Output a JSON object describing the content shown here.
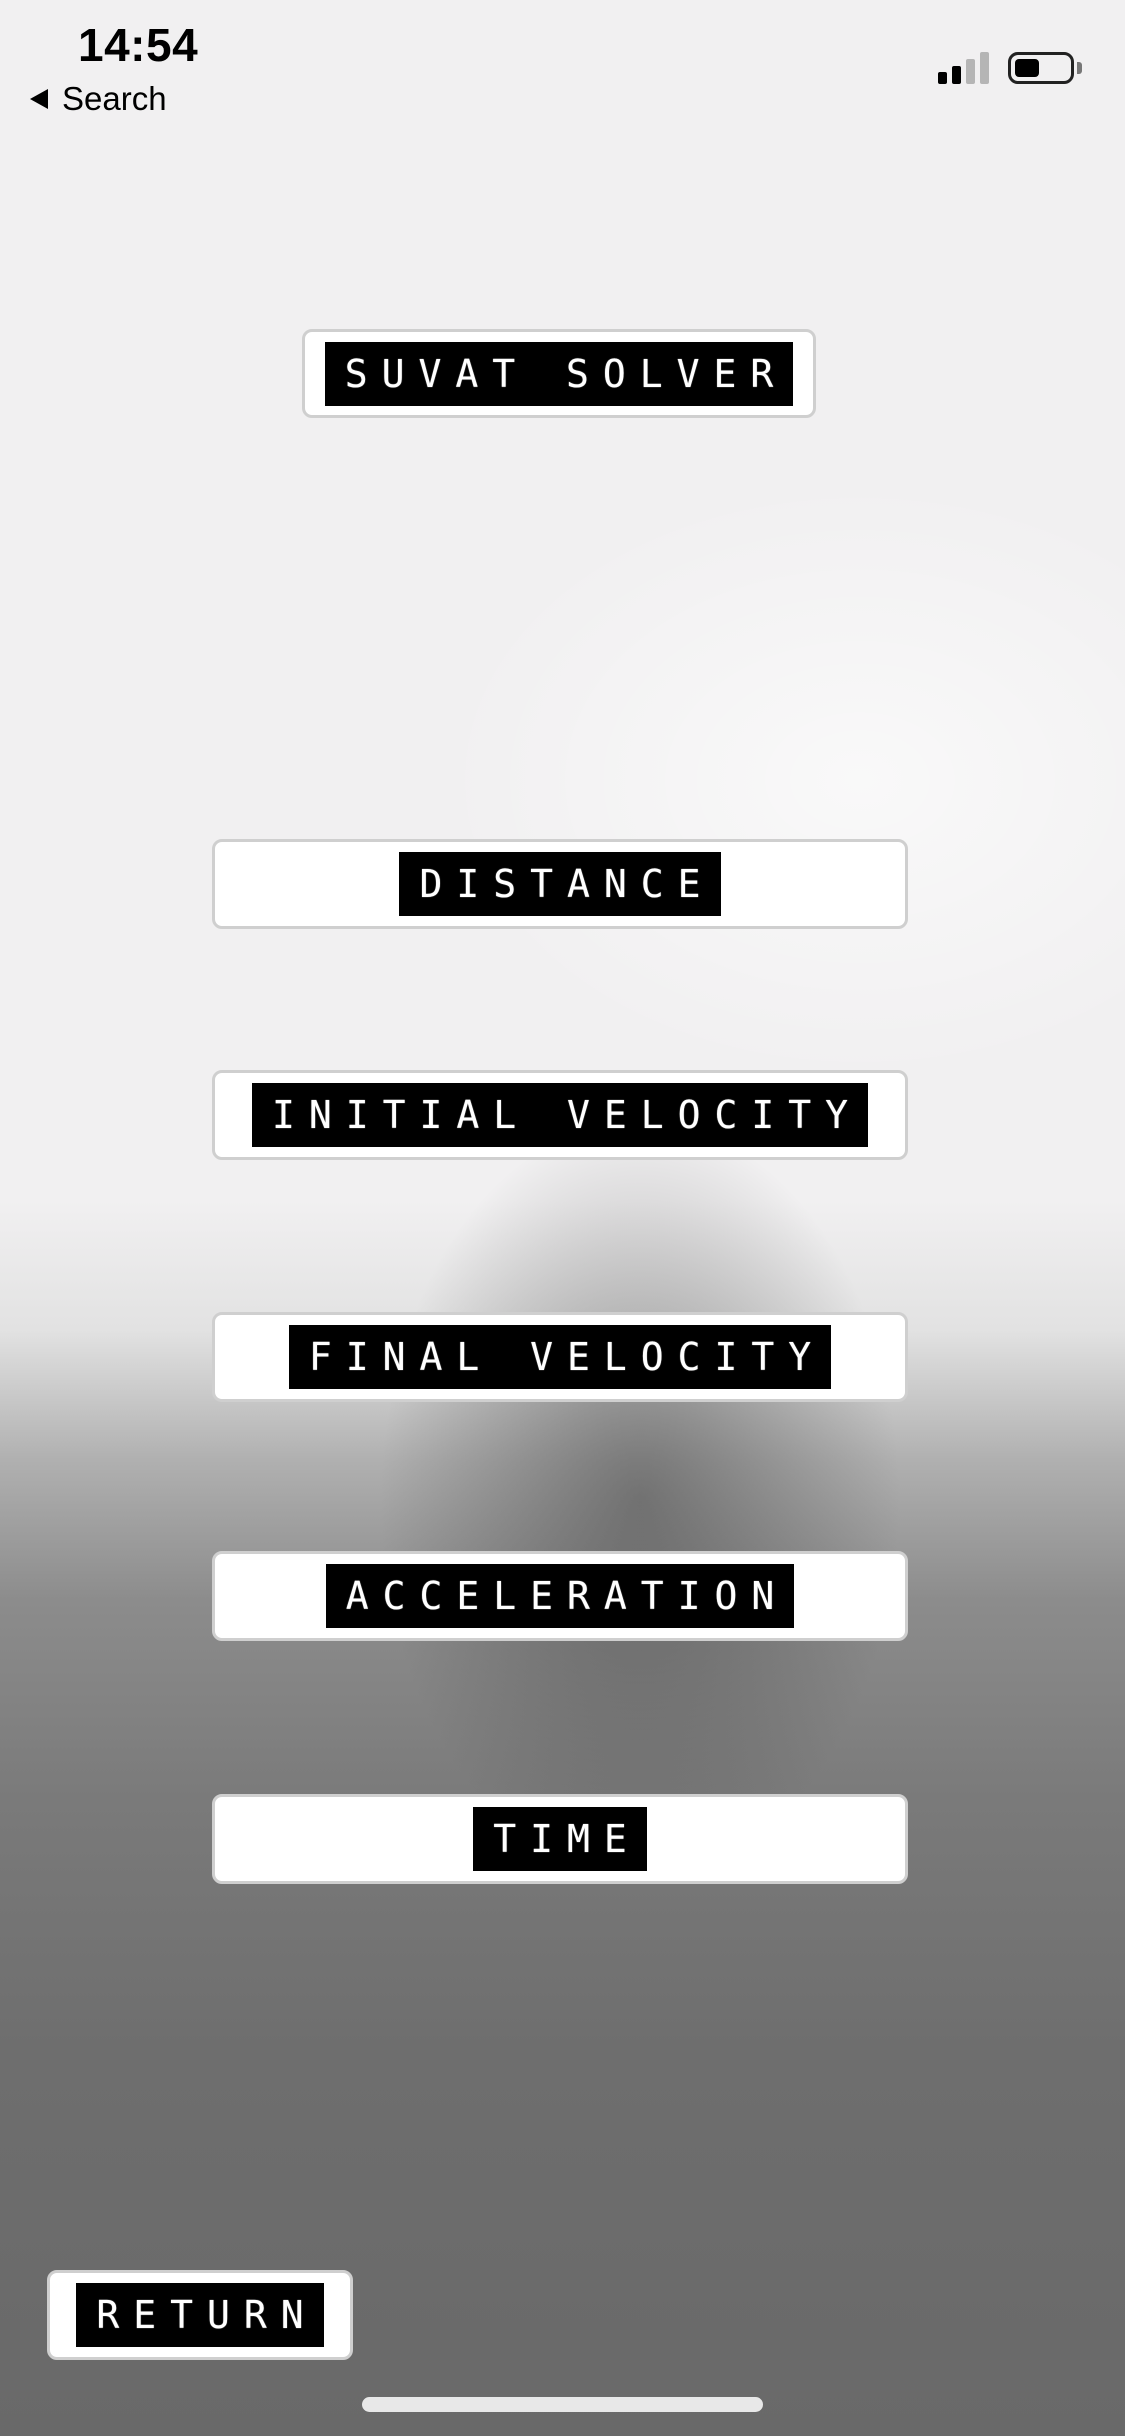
{
  "status_bar": {
    "time": "14:54",
    "back_label": "Search",
    "battery_level": 0.45,
    "signal_bars_active": 2,
    "signal_bars_total": 4
  },
  "title": {
    "label": "SUVAT SOLVER"
  },
  "options": {
    "distance": "DISTANCE",
    "initial_velocity": "INITIAL VELOCITY",
    "final_velocity": "FINAL VELOCITY",
    "acceleration": "ACCELERATION",
    "time": "TIME"
  },
  "footer": {
    "return_label": "RETURN"
  },
  "colors": {
    "tape_background": "#000000",
    "tape_text": "#ffffff",
    "box_background": "#ffffff",
    "box_border": "#cfcfcf"
  }
}
